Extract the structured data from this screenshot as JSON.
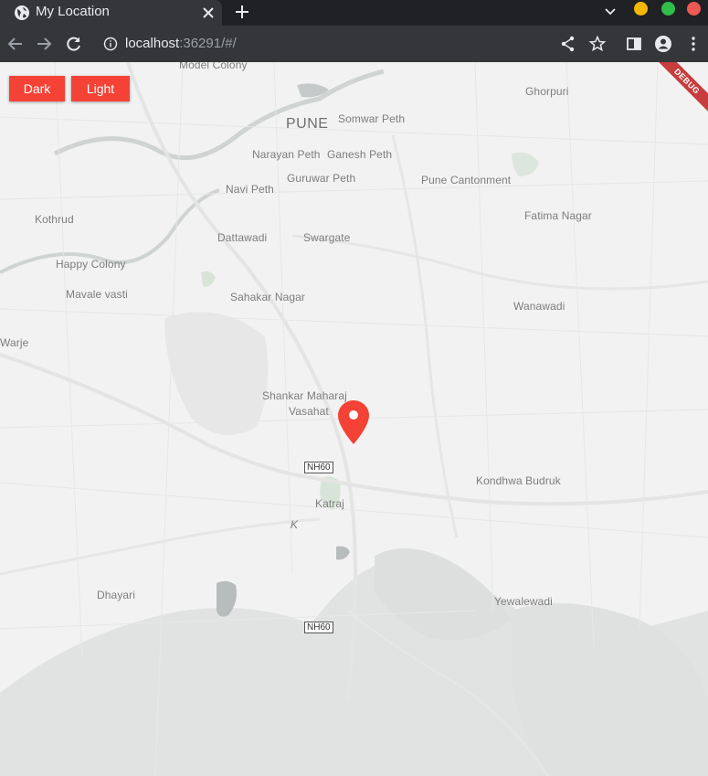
{
  "browser": {
    "tab_title": "My Location",
    "url_host": "localhost",
    "url_rest": ":36291/#/"
  },
  "controls": {
    "dark_label": "Dark",
    "light_label": "Light"
  },
  "debug_label": "DEBUG",
  "map": {
    "city": "PUNE",
    "places": {
      "model_colony": "Model Colony",
      "somwar_peth": "Somwar Peth",
      "ghorpuri": "Ghorpuri",
      "narayan_peth": "Narayan Peth",
      "ganesh_peth": "Ganesh Peth",
      "guruwar_peth": "Guruwar Peth",
      "pune_cantonment": "Pune Cantonment",
      "navi_peth": "Navi Peth",
      "kothrud": "Kothrud",
      "fatima_nagar": "Fatima Nagar",
      "dattawadi": "Dattawadi",
      "swargate": "Swargate",
      "happy_colony": "Happy Colony",
      "mavale_vasti": "Mavale vasti",
      "sahakar_nagar": "Sahakar Nagar",
      "wanawadi": "Wanawadi",
      "warje": "Warje",
      "shankar_maharaj": "Shankar Maharaj",
      "vasahat": "Vasahat",
      "kondhwa_budruk": "Kondhwa Budruk",
      "katraj": "Katraj",
      "k": "K",
      "dhayari": "Dhayari",
      "yewalewadi": "Yewalewadi"
    },
    "highway_1": "NH60",
    "highway_2": "NH60"
  }
}
